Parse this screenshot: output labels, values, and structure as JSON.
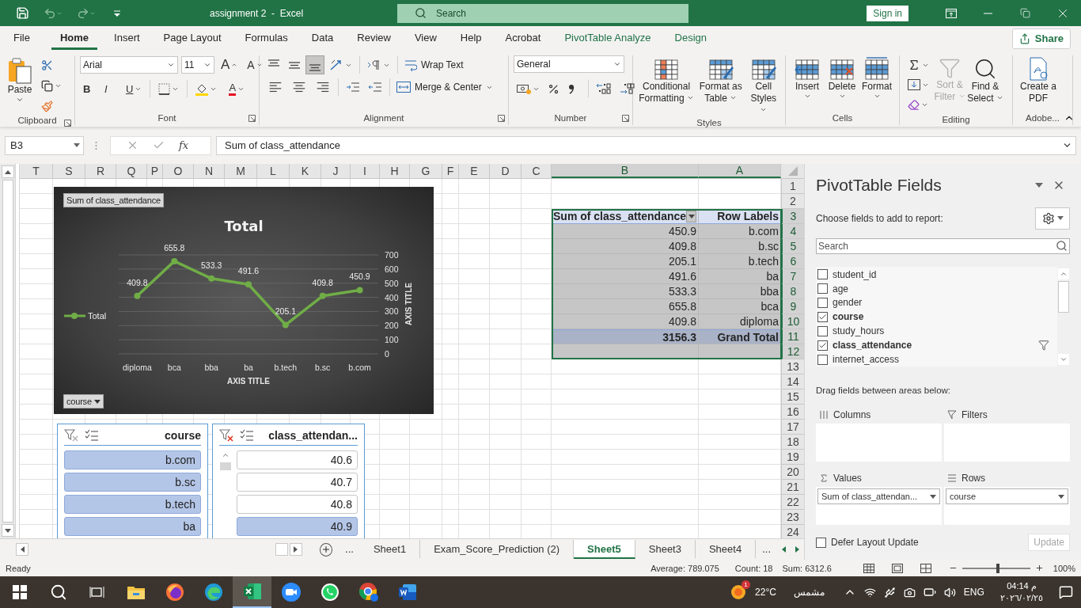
{
  "title_bar": {
    "title": "assignment 2  -  Excel",
    "search_placeholder": "Search",
    "sign_in": "Sign in"
  },
  "menu_tabs": [
    {
      "label": "File",
      "selected": false,
      "contextual": false
    },
    {
      "label": "Home",
      "selected": true,
      "contextual": false
    },
    {
      "label": "Insert",
      "selected": false,
      "contextual": false
    },
    {
      "label": "Page Layout",
      "selected": false,
      "contextual": false
    },
    {
      "label": "Formulas",
      "selected": false,
      "contextual": false
    },
    {
      "label": "Data",
      "selected": false,
      "contextual": false
    },
    {
      "label": "Review",
      "selected": false,
      "contextual": false
    },
    {
      "label": "View",
      "selected": false,
      "contextual": false
    },
    {
      "label": "Help",
      "selected": false,
      "contextual": false
    },
    {
      "label": "Acrobat",
      "selected": false,
      "contextual": false
    },
    {
      "label": "PivotTable Analyze",
      "selected": false,
      "contextual": true
    },
    {
      "label": "Design",
      "selected": false,
      "contextual": true
    }
  ],
  "share": "Share",
  "ribbon": {
    "clipboard": {
      "label": "Clipboard",
      "paste": "Paste"
    },
    "font": {
      "label": "Font",
      "name": "Arial",
      "size": "11",
      "grow": "A",
      "shrink": "A",
      "bold": "B",
      "italic": "I",
      "underline": "U",
      "color_letter": "A"
    },
    "alignment": {
      "label": "Alignment",
      "bottom_align": {
        "on": true
      },
      "wrap_text": "Wrap Text",
      "merge": "Merge & Center"
    },
    "number": {
      "label": "Number",
      "format": "General"
    },
    "styles": {
      "label": "Styles",
      "buttons": [
        {
          "label": "Conditional Formatting",
          "kind": "conditional"
        },
        {
          "label": "Format as Table",
          "kind": "table"
        },
        {
          "label": "Cell Styles",
          "kind": "cellstyle"
        }
      ]
    },
    "cells": {
      "label": "Cells",
      "buttons": [
        {
          "label": "Insert",
          "kind": "insert"
        },
        {
          "label": "Delete",
          "kind": "delete"
        },
        {
          "label": "Format",
          "kind": "format"
        }
      ]
    },
    "editing": {
      "label": "Editing",
      "sort_filter": {
        "label": "Sort & Filter",
        "disabled": true
      },
      "find_select": "Find & Select"
    },
    "adobe": {
      "label": "Adobe...",
      "create_pdf": "Create a PDF"
    }
  },
  "formula_bar": {
    "name_box": "B3",
    "fx": "fx",
    "formula": "Sum of class_attendance"
  },
  "sheet": {
    "columns": [
      {
        "label": "T",
        "selected": false
      },
      {
        "label": "S",
        "selected": false
      },
      {
        "label": "R",
        "selected": false
      },
      {
        "label": "Q",
        "selected": false
      },
      {
        "label": "P",
        "selected": false
      },
      {
        "label": "O",
        "selected": false
      },
      {
        "label": "N",
        "selected": false
      },
      {
        "label": "M",
        "selected": false
      },
      {
        "label": "L",
        "selected": false
      },
      {
        "label": "K",
        "selected": false
      },
      {
        "label": "J",
        "selected": false
      },
      {
        "label": "I",
        "selected": false
      },
      {
        "label": "H",
        "selected": false
      },
      {
        "label": "G",
        "selected": false
      },
      {
        "label": "F",
        "selected": false
      },
      {
        "label": "E",
        "selected": false
      },
      {
        "label": "D",
        "selected": false
      },
      {
        "label": "C",
        "selected": false
      },
      {
        "label": "B",
        "selected": true
      },
      {
        "label": "A",
        "selected": true
      }
    ],
    "rows": [
      {
        "label": "1",
        "selected": false
      },
      {
        "label": "2",
        "selected": false
      },
      {
        "label": "3",
        "selected": true
      },
      {
        "label": "4",
        "selected": true
      },
      {
        "label": "5",
        "selected": true
      },
      {
        "label": "6",
        "selected": true
      },
      {
        "label": "7",
        "selected": true
      },
      {
        "label": "8",
        "selected": true
      },
      {
        "label": "9",
        "selected": true
      },
      {
        "label": "10",
        "selected": true
      },
      {
        "label": "11",
        "selected": true
      },
      {
        "label": "12",
        "selected": true
      },
      {
        "label": "13",
        "selected": false
      },
      {
        "label": "14",
        "selected": false
      },
      {
        "label": "15",
        "selected": false
      },
      {
        "label": "16",
        "selected": false
      },
      {
        "label": "17",
        "selected": false
      },
      {
        "label": "18",
        "selected": false
      },
      {
        "label": "19",
        "selected": false
      },
      {
        "label": "20",
        "selected": false
      },
      {
        "label": "21",
        "selected": false
      },
      {
        "label": "22",
        "selected": false
      },
      {
        "label": "23",
        "selected": false
      },
      {
        "label": "24",
        "selected": false
      }
    ]
  },
  "pivot_table": {
    "value_header": "Sum of class_attendance",
    "label_header": "Row Labels",
    "rows": [
      {
        "value": "450.9",
        "label": "b.com"
      },
      {
        "value": "409.8",
        "label": "b.sc"
      },
      {
        "value": "205.1",
        "label": "b.tech"
      },
      {
        "value": "491.6",
        "label": "ba"
      },
      {
        "value": "533.3",
        "label": "bba"
      },
      {
        "value": "655.8",
        "label": "bca"
      },
      {
        "value": "409.8",
        "label": "diploma"
      }
    ],
    "total": {
      "value": "3156.3",
      "label": "Grand Total"
    }
  },
  "chart": {
    "field_button": "Sum of class_attendance",
    "axis_button": "course",
    "chart_data": {
      "type": "line",
      "title": "Total",
      "xlabel": "AXIS TITLE",
      "ylabel": "AXIS TITLE",
      "categories": [
        "diploma",
        "bca",
        "bba",
        "ba",
        "b.tech",
        "b.sc",
        "b.com"
      ],
      "series": [
        {
          "name": "Total",
          "color": "#70ad47",
          "marker": "circle",
          "values": [
            409.8,
            655.8,
            533.3,
            491.6,
            205.1,
            409.8,
            450.9
          ]
        }
      ],
      "ylim": [
        0,
        700
      ],
      "yticks": [
        0,
        100,
        200,
        300,
        400,
        500,
        600,
        700
      ],
      "data_labels": true,
      "grid": true
    }
  },
  "slicers": [
    {
      "title": "course",
      "filtered": false,
      "scrollbar": false,
      "items": [
        {
          "label": "b.com",
          "selected": true
        },
        {
          "label": "b.sc",
          "selected": true
        },
        {
          "label": "b.tech",
          "selected": true
        },
        {
          "label": "ba",
          "selected": true
        }
      ]
    },
    {
      "title": "class_attendan...",
      "filtered": true,
      "scrollbar": true,
      "items": [
        {
          "label": "40.6",
          "selected": false
        },
        {
          "label": "40.7",
          "selected": false
        },
        {
          "label": "40.8",
          "selected": false
        },
        {
          "label": "40.9",
          "selected": true
        }
      ]
    }
  ],
  "sheet_tabs": [
    {
      "label": "...",
      "kind": "more",
      "selected": false
    },
    {
      "label": "Sheet1",
      "kind": "sheet",
      "selected": false
    },
    {
      "label": "Exam_Score_Prediction (2)",
      "kind": "sheet",
      "selected": false
    },
    {
      "label": "Sheet5",
      "kind": "sheet",
      "selected": true
    },
    {
      "label": "Sheet3",
      "kind": "sheet",
      "selected": false
    },
    {
      "label": "Sheet4",
      "kind": "sheet",
      "selected": false
    },
    {
      "label": "...",
      "kind": "more",
      "selected": false
    }
  ],
  "field_pane": {
    "title": "PivotTable Fields",
    "subtitle": "Choose fields to add to report:",
    "search_placeholder": "Search",
    "fields": [
      {
        "name": "student_id",
        "checked": false,
        "filtered": false
      },
      {
        "name": "age",
        "checked": false,
        "filtered": false
      },
      {
        "name": "gender",
        "checked": false,
        "filtered": false
      },
      {
        "name": "course",
        "checked": true,
        "filtered": false
      },
      {
        "name": "study_hours",
        "checked": false,
        "filtered": false
      },
      {
        "name": "class_attendance",
        "checked": true,
        "filtered": true
      },
      {
        "name": "internet_access",
        "checked": false,
        "filtered": false
      }
    ],
    "areas_hint": "Drag fields between areas below:",
    "areas": [
      {
        "title": "Columns",
        "kind": "columns"
      },
      {
        "title": "Filters",
        "kind": "filters"
      },
      {
        "title": "Values",
        "kind": "values",
        "items": [
          "Sum of class_attendan..."
        ]
      },
      {
        "title": "Rows",
        "kind": "rows",
        "items": [
          "course"
        ]
      }
    ],
    "defer": {
      "label": "Defer Layout Update",
      "checked": false
    },
    "update": {
      "label": "Update",
      "disabled": true
    }
  },
  "status_bar": {
    "ready": "Ready",
    "average": "Average: 789.075",
    "count": "Count: 18",
    "sum": "Sum: 6312.6",
    "zoom": {
      "level": 0.5
    },
    "zoom_label": "100%"
  },
  "taskbar": {
    "weather": {
      "badge": "1",
      "temp": "22°C",
      "condition": "مشمس"
    },
    "language": "ENG",
    "time": "م 04:14",
    "date": "٢٠٢٦/٠٢/٢٥"
  }
}
